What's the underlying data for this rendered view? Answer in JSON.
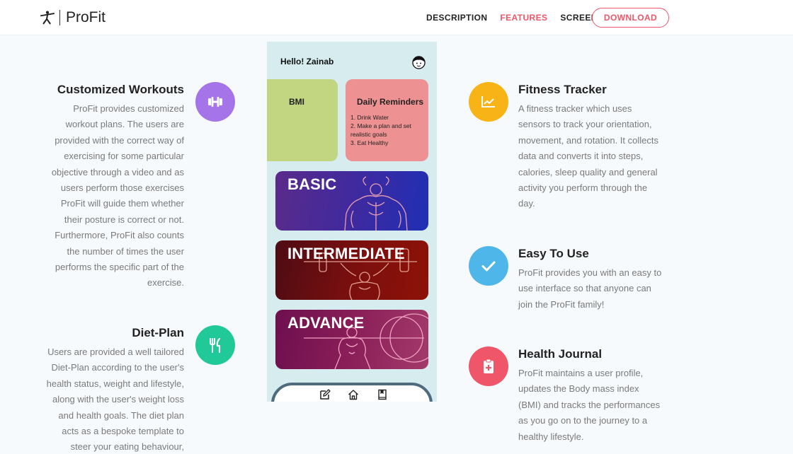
{
  "header": {
    "brand": "ProFit",
    "nav": [
      {
        "label": "DESCRIPTION",
        "active": false
      },
      {
        "label": "FEATURES",
        "active": true
      },
      {
        "label": "SCREENS",
        "active": false
      }
    ],
    "download_label": "DOWNLOAD"
  },
  "colors": {
    "accent": "#f0566a",
    "purple": "#a474e8",
    "green": "#20c997",
    "orange": "#f8b316",
    "blue": "#4fb6ea",
    "pink": "#f0566a"
  },
  "features_left": [
    {
      "title": "Customized Workouts",
      "icon": "dumbbell-icon",
      "lines": [
        "ProFit provides customized",
        "workout plans. The users are",
        "provided with the correct way of",
        "exercising for some particular",
        "objective through a video and as",
        "users perform those exercises",
        "ProFit will guide them whether",
        "their posture is correct or not.",
        "Furthermore, ProFit also counts",
        "the number of times the user",
        "performs the specific part of the",
        "exercise."
      ]
    },
    {
      "title": "Diet-Plan",
      "icon": "utensils-icon",
      "lines": [
        "Users are provided a well tailored",
        "Diet-Plan according to the user's",
        "health status, weight and lifestyle,",
        "along with the user's weight loss",
        "and health goals. The diet plan",
        "acts as a bespoke template to",
        "steer your eating behaviour,"
      ]
    }
  ],
  "features_right": [
    {
      "title": "Fitness Tracker",
      "icon": "chart-line-icon",
      "lines": [
        "A fitness tracker which uses",
        "sensors to track your orientation,",
        "movement, and rotation. It collects",
        "data and converts it into steps,",
        "calories, sleep quality and general",
        "activity you perform through the",
        "day."
      ]
    },
    {
      "title": "Easy To Use",
      "icon": "check-icon",
      "lines": [
        "ProFit provides you with an easy to",
        "use interface so that anyone can",
        "join the ProFit family!"
      ]
    },
    {
      "title": "Health Journal",
      "icon": "medical-clipboard-icon",
      "lines": [
        "ProFit maintains a user profile,",
        "updates the Body mass index",
        "(BMI) and tracks the performances",
        "as you go on to the journey to a",
        "healthy lifestyle."
      ]
    }
  ],
  "phone": {
    "greeting": "Hello! Zainab",
    "bmi_label": "BMI",
    "reminders_title": "Daily Reminders",
    "reminders": [
      "1. Drink Water",
      "2. Make a plan and set realistic goals",
      "3. Eat Healthy"
    ],
    "levels": [
      "BASIC",
      "INTERMEDIATE",
      "ADVANCE"
    ]
  }
}
